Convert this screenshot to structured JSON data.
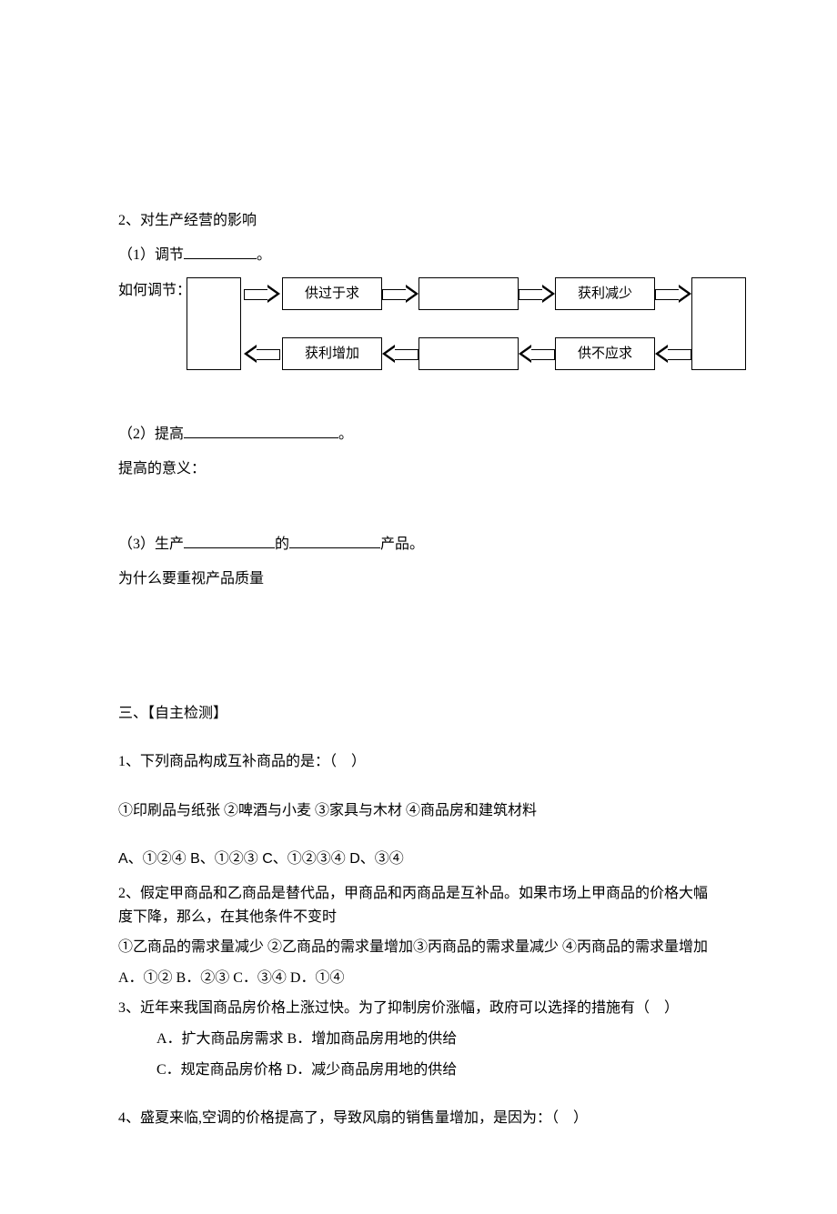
{
  "section2": {
    "title": "2、对生产经营的影响",
    "item1_prefix": "（1）调节",
    "item1_suffix": "。",
    "diagram_label": "如何调节：",
    "box_top2": "供过于求",
    "box_top4": "获利减少",
    "box_bot2": "获利增加",
    "box_bot4": "供不应求",
    "item2_prefix": "（2）提高",
    "item2_suffix": "。",
    "item2_sub": "提高的意义：",
    "item3_prefix": "（3）生产",
    "item3_mid": "的",
    "item3_suffix": "产品。",
    "item3_sub": "为什么要重视产品质量"
  },
  "section3": {
    "title": "三、【自主检测】",
    "q1": {
      "stem": "1、下列商品构成互补商品的是：（　）",
      "given": "①印刷品与纸张  ②啤酒与小麦  ③家具与木材  ④商品房和建筑材料",
      "opts": "A、①②④    B、①②③    C、①②③④    D、③④"
    },
    "q2": {
      "stem1": "2、假定甲商品和乙商品是替代品，甲商品和丙商品是互补品。如果市场上甲商品的价格大幅度下降，那么，在其他条件不变时",
      "given": "①乙商品的需求量减少 ②乙商品的需求量增加③丙商品的需求量减少 ④丙商品的需求量增加",
      "opts": "A．①②    B．②③    C．③④    D．①④"
    },
    "q3": {
      "stem": "3、近年来我国商品房价格上涨过快。为了抑制房价涨幅，政府可以选择的措施有（　）",
      "opts1": "A．扩大商品房需求      B．增加商品房用地的供给",
      "opts2": "C．规定商品房价格      D．减少商品房用地的供给"
    },
    "q4": {
      "stem": "4、盛夏来临,空调的价格提高了，导致风扇的销售量增加，是因为：（　）"
    }
  }
}
